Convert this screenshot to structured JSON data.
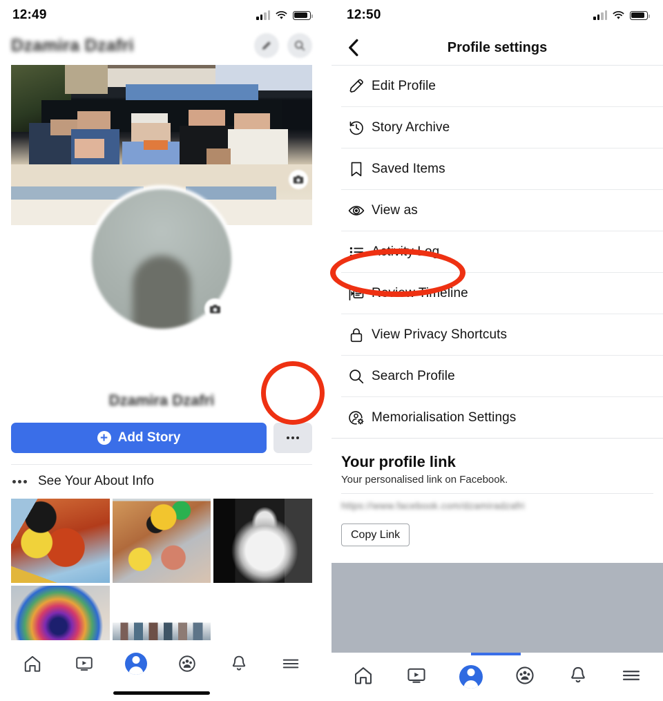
{
  "left_screen": {
    "status_bar": {
      "time": "12:49",
      "icons": [
        "signal-icon",
        "wifi-icon",
        "battery-icon"
      ]
    },
    "header": {
      "name_blurred": "Dzamira Dzafri",
      "actions": [
        {
          "name": "edit-profile-icon-button",
          "icon": "pencil-icon"
        },
        {
          "name": "search-icon-button",
          "icon": "search-icon"
        }
      ]
    },
    "cover_photo": {
      "alt": "group photo cover",
      "camera_button": "camera-icon"
    },
    "avatar": {
      "alt": "profile picture",
      "camera_button": "camera-icon"
    },
    "full_name_blurred": "Dzamira Dzafri",
    "add_story_label": "Add Story",
    "add_story_plus": "+",
    "more_button": "...",
    "about_row_label": "See Your About Info",
    "photo_grid_count": 5,
    "bottom_nav": [
      {
        "label": "Home",
        "icon": "home-icon",
        "active": false
      },
      {
        "label": "Watch",
        "icon": "video-icon",
        "active": false
      },
      {
        "label": "Profile",
        "icon": "profile-icon",
        "active": true
      },
      {
        "label": "Groups",
        "icon": "groups-icon",
        "active": false
      },
      {
        "label": "Notifications",
        "icon": "bell-icon",
        "active": false
      },
      {
        "label": "Menu",
        "icon": "hamburger-icon",
        "active": false
      }
    ]
  },
  "right_screen": {
    "status_bar": {
      "time": "12:50",
      "icons": [
        "signal-icon",
        "wifi-icon",
        "battery-icon"
      ]
    },
    "nav": {
      "back_icon": "chevron-left-icon",
      "title": "Profile settings"
    },
    "menu_items": [
      {
        "label": "Edit Profile",
        "icon": "pencil-icon"
      },
      {
        "label": "Story Archive",
        "icon": "clock-history-icon"
      },
      {
        "label": "Saved Items",
        "icon": "bookmark-icon"
      },
      {
        "label": "View as",
        "icon": "eye-icon"
      },
      {
        "label": "Activity Log",
        "icon": "list-icon",
        "highlighted": true
      },
      {
        "label": "Review Timeline",
        "icon": "timeline-review-icon"
      },
      {
        "label": "View Privacy Shortcuts",
        "icon": "lock-icon"
      },
      {
        "label": "Search Profile",
        "icon": "search-icon"
      },
      {
        "label": "Memorialisation Settings",
        "icon": "person-gear-icon"
      }
    ],
    "profile_link": {
      "title": "Your profile link",
      "subtitle": "Your personalised link on Facebook.",
      "url_blurred": "https://www.facebook.com/dzamiradzafri",
      "copy_button": "Copy Link"
    },
    "bottom_nav": [
      {
        "label": "Home",
        "icon": "home-icon",
        "active": false
      },
      {
        "label": "Watch",
        "icon": "video-icon",
        "active": false
      },
      {
        "label": "Profile",
        "icon": "profile-icon",
        "active": true
      },
      {
        "label": "Groups",
        "icon": "groups-icon",
        "active": false
      },
      {
        "label": "Notifications",
        "icon": "bell-icon",
        "active": false
      },
      {
        "label": "Menu",
        "icon": "hamburger-icon",
        "active": false
      }
    ]
  },
  "annotations": [
    {
      "name": "highlight-more-button",
      "shape": "circle",
      "color": "#ee3112"
    },
    {
      "name": "highlight-activity-log",
      "shape": "ellipse",
      "color": "#ee3112"
    }
  ],
  "colors": {
    "brand_blue": "#3a6ee8",
    "annotation_red": "#ee3112",
    "grey_surface": "#e4e6eb",
    "blur_block": "#aeb4bd"
  }
}
